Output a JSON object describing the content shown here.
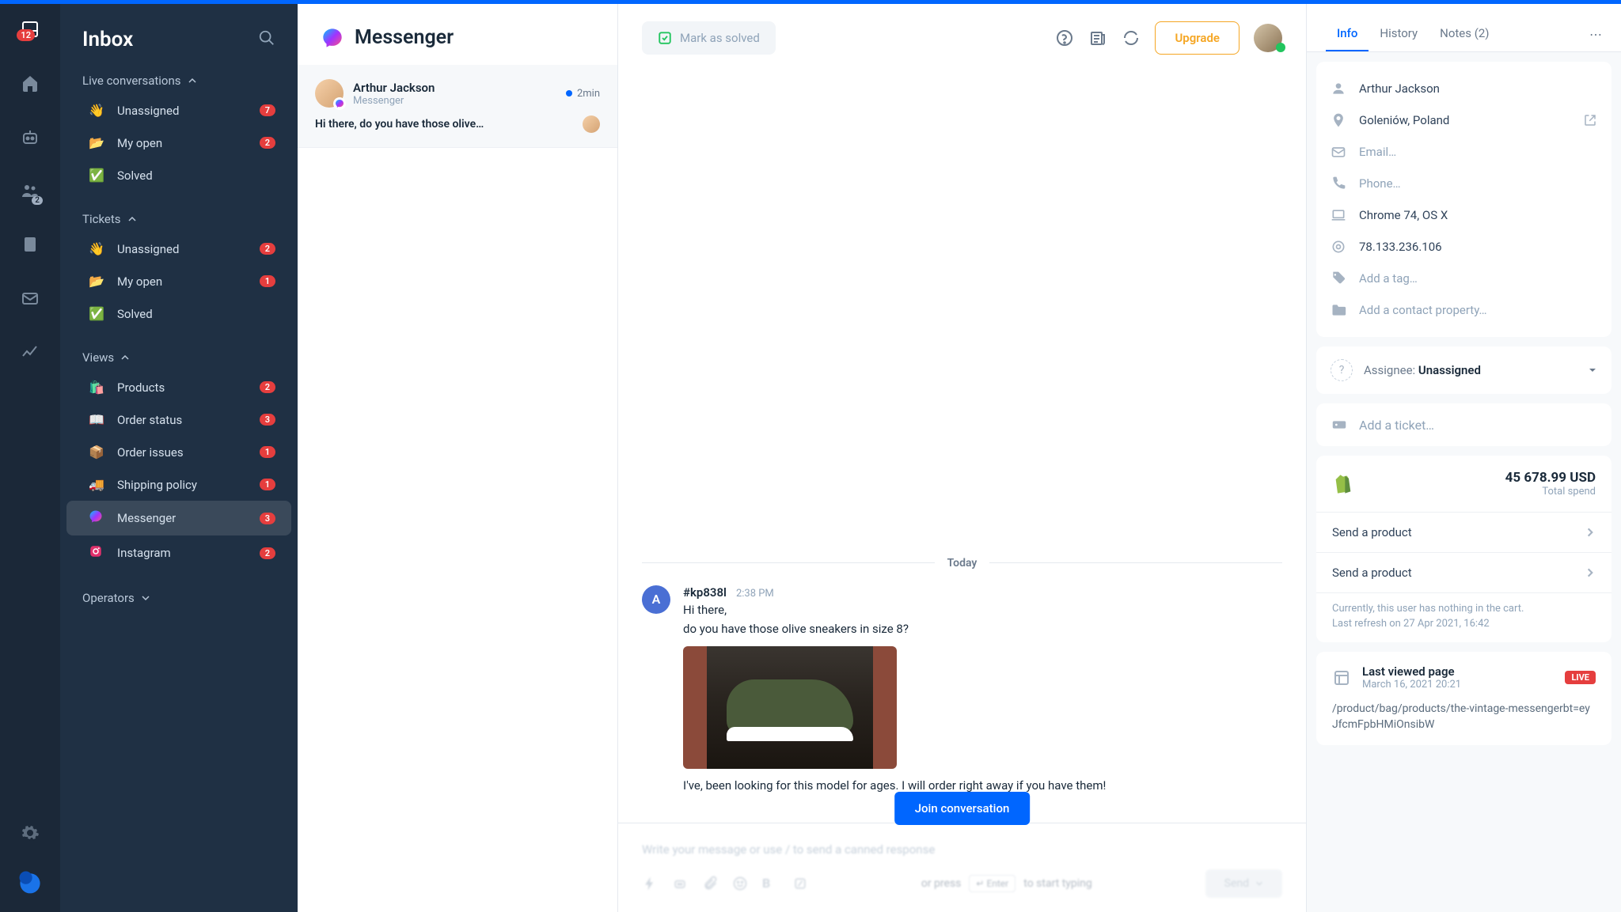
{
  "app": {
    "inbox_title": "Inbox",
    "rail_badge": "12",
    "rail_people_badge": "2"
  },
  "sidebar": {
    "sections": {
      "live": {
        "title": "Live conversations",
        "items": [
          {
            "emoji": "👋",
            "label": "Unassigned",
            "count": "7"
          },
          {
            "emoji": "📂",
            "label": "My open",
            "count": "2"
          },
          {
            "emoji": "✅",
            "label": "Solved",
            "count": ""
          }
        ]
      },
      "tickets": {
        "title": "Tickets",
        "items": [
          {
            "emoji": "👋",
            "label": "Unassigned",
            "count": "2"
          },
          {
            "emoji": "📂",
            "label": "My open",
            "count": "1"
          },
          {
            "emoji": "✅",
            "label": "Solved",
            "count": ""
          }
        ]
      },
      "views": {
        "title": "Views",
        "items": [
          {
            "emoji": "🛍️",
            "label": "Products",
            "count": "2"
          },
          {
            "emoji": "📖",
            "label": "Order status",
            "count": "3"
          },
          {
            "emoji": "📦",
            "label": "Order issues",
            "count": "1"
          },
          {
            "emoji": "🚚",
            "label": "Shipping policy",
            "count": "1"
          },
          {
            "emoji": "💬",
            "label": "Messenger",
            "count": "3",
            "selected": true
          },
          {
            "emoji": "📷",
            "label": "Instagram",
            "count": "2"
          }
        ]
      },
      "operators": {
        "title": "Operators"
      }
    }
  },
  "conversations": {
    "channel_title": "Messenger",
    "items": [
      {
        "name": "Arthur Jackson",
        "source": "Messenger",
        "time": "2min",
        "preview": "Hi there, do you have those olive…"
      }
    ]
  },
  "chat": {
    "mark_solved": "Mark as solved",
    "upgrade": "Upgrade",
    "date_divider": "Today",
    "messages": [
      {
        "avatar": "A",
        "id": "#kp838l",
        "time": "2:38 PM",
        "lines": [
          "Hi there,",
          "do you have those olive sneakers in size 8?"
        ],
        "after_image": "I've, been looking for this model for ages. I will order right away if you have them!"
      }
    ],
    "input_placeholder": "Write your message or use / to send a canned response",
    "join_label": "Join conversation",
    "or_press": "or press",
    "enter_key": "↵ Enter",
    "to_start": "to start typing",
    "send": "Send"
  },
  "details": {
    "tabs": {
      "info": "Info",
      "history": "History",
      "notes": "Notes (2)"
    },
    "contact": {
      "name": "Arthur Jackson",
      "location": "Goleniów, Poland",
      "email": "Email…",
      "phone": "Phone…",
      "browser": "Chrome 74, OS X",
      "ip": "78.133.236.106",
      "tag": "Add a tag…",
      "property": "Add a contact property…"
    },
    "assignee": {
      "label": "Assignee:",
      "value": "Unassigned"
    },
    "ticket": {
      "add": "Add a ticket…"
    },
    "shopify": {
      "amount": "45 678.99 USD",
      "amount_label": "Total spend",
      "action1": "Send a product",
      "action2": "Send a product",
      "cart_note": "Currently, this user has nothing in the cart.",
      "refresh": "Last refresh on 27 Apr 2021, 16:42"
    },
    "lastview": {
      "title": "Last viewed page",
      "date": "March 16, 2021 20:21",
      "live": "LIVE",
      "url": "/product/bag/products/the-vintage-messengerbt=eyJfcmFpbHMiOnsibW"
    }
  }
}
